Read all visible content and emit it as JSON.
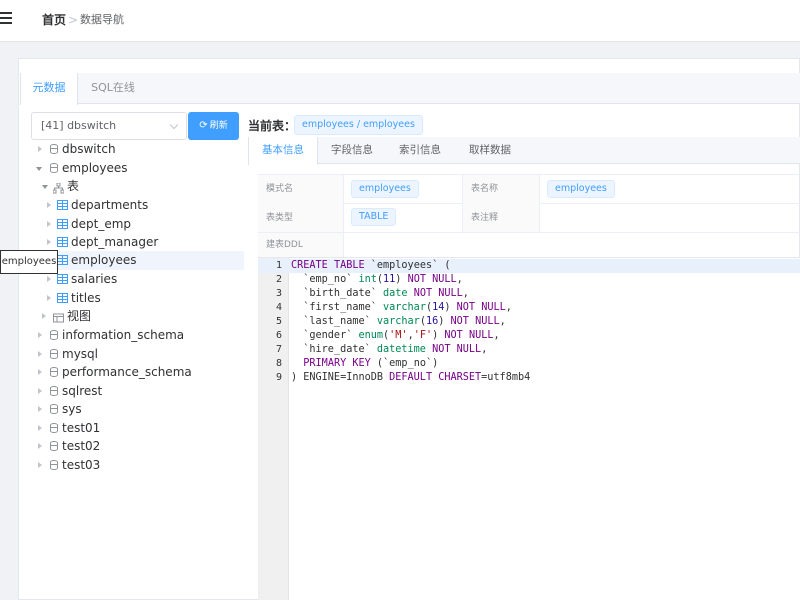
{
  "breadcrumb": {
    "home": "首页",
    "separator": ">",
    "current": "数据导航"
  },
  "outer_tabs": [
    {
      "label": "元数据",
      "active": true
    },
    {
      "label": "SQL在线",
      "active": false
    }
  ],
  "datasource": {
    "selected": "[41] dbswitch",
    "refresh_label": "刷新",
    "refresh_icon": "refresh-icon"
  },
  "tree": {
    "dbswitch": "dbswitch",
    "employees": "employees",
    "tables_group": "表",
    "tables": [
      "departments",
      "dept_emp",
      "dept_manager",
      "employees",
      "salaries",
      "titles"
    ],
    "views_group": "视图",
    "schemas": [
      "information_schema",
      "mysql",
      "performance_schema",
      "sqlrest",
      "sys",
      "test01",
      "test02",
      "test03"
    ]
  },
  "tooltip": "employees",
  "current_table": {
    "label": "当前表：",
    "value": "employees / employees"
  },
  "inner_tabs": [
    {
      "label": "基本信息",
      "active": true
    },
    {
      "label": "字段信息",
      "active": false
    },
    {
      "label": "索引信息",
      "active": false
    },
    {
      "label": "取样数据",
      "active": false
    }
  ],
  "info": {
    "schema_label": "模式名",
    "schema_value": "employees",
    "table_name_label": "表名称",
    "table_name_value": "employees",
    "table_type_label": "表类型",
    "table_type_value": "TABLE",
    "table_comment_label": "表注释",
    "table_comment_value": "",
    "ddl_label": "建表DDL"
  },
  "ddl_lines": [
    "CREATE TABLE `employees` (",
    "  `emp_no` int(11) NOT NULL,",
    "  `birth_date` date NOT NULL,",
    "  `first_name` varchar(14) NOT NULL,",
    "  `last_name` varchar(16) NOT NULL,",
    "  `gender` enum('M','F') NOT NULL,",
    "  `hire_date` datetime NOT NULL,",
    "  PRIMARY KEY (`emp_no`)",
    ") ENGINE=InnoDB DEFAULT CHARSET=utf8mb4"
  ],
  "colors": {
    "accent": "#409eff",
    "keyword": "#770088",
    "type": "#008855",
    "string": "#aa1111"
  }
}
